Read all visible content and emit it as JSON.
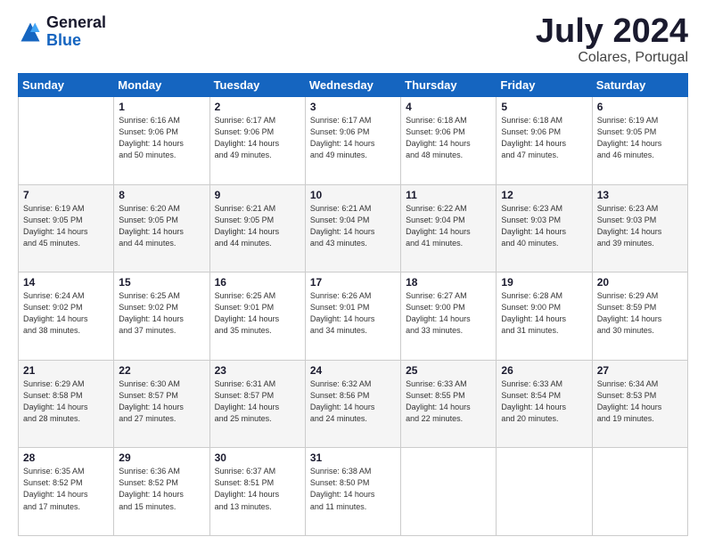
{
  "header": {
    "logo_general": "General",
    "logo_blue": "Blue",
    "title": "July 2024",
    "subtitle": "Colares, Portugal"
  },
  "weekdays": [
    "Sunday",
    "Monday",
    "Tuesday",
    "Wednesday",
    "Thursday",
    "Friday",
    "Saturday"
  ],
  "weeks": [
    [
      {
        "num": "",
        "info": ""
      },
      {
        "num": "1",
        "info": "Sunrise: 6:16 AM\nSunset: 9:06 PM\nDaylight: 14 hours\nand 50 minutes."
      },
      {
        "num": "2",
        "info": "Sunrise: 6:17 AM\nSunset: 9:06 PM\nDaylight: 14 hours\nand 49 minutes."
      },
      {
        "num": "3",
        "info": "Sunrise: 6:17 AM\nSunset: 9:06 PM\nDaylight: 14 hours\nand 49 minutes."
      },
      {
        "num": "4",
        "info": "Sunrise: 6:18 AM\nSunset: 9:06 PM\nDaylight: 14 hours\nand 48 minutes."
      },
      {
        "num": "5",
        "info": "Sunrise: 6:18 AM\nSunset: 9:06 PM\nDaylight: 14 hours\nand 47 minutes."
      },
      {
        "num": "6",
        "info": "Sunrise: 6:19 AM\nSunset: 9:05 PM\nDaylight: 14 hours\nand 46 minutes."
      }
    ],
    [
      {
        "num": "7",
        "info": "Sunrise: 6:19 AM\nSunset: 9:05 PM\nDaylight: 14 hours\nand 45 minutes."
      },
      {
        "num": "8",
        "info": "Sunrise: 6:20 AM\nSunset: 9:05 PM\nDaylight: 14 hours\nand 44 minutes."
      },
      {
        "num": "9",
        "info": "Sunrise: 6:21 AM\nSunset: 9:05 PM\nDaylight: 14 hours\nand 44 minutes."
      },
      {
        "num": "10",
        "info": "Sunrise: 6:21 AM\nSunset: 9:04 PM\nDaylight: 14 hours\nand 43 minutes."
      },
      {
        "num": "11",
        "info": "Sunrise: 6:22 AM\nSunset: 9:04 PM\nDaylight: 14 hours\nand 41 minutes."
      },
      {
        "num": "12",
        "info": "Sunrise: 6:23 AM\nSunset: 9:03 PM\nDaylight: 14 hours\nand 40 minutes."
      },
      {
        "num": "13",
        "info": "Sunrise: 6:23 AM\nSunset: 9:03 PM\nDaylight: 14 hours\nand 39 minutes."
      }
    ],
    [
      {
        "num": "14",
        "info": "Sunrise: 6:24 AM\nSunset: 9:02 PM\nDaylight: 14 hours\nand 38 minutes."
      },
      {
        "num": "15",
        "info": "Sunrise: 6:25 AM\nSunset: 9:02 PM\nDaylight: 14 hours\nand 37 minutes."
      },
      {
        "num": "16",
        "info": "Sunrise: 6:25 AM\nSunset: 9:01 PM\nDaylight: 14 hours\nand 35 minutes."
      },
      {
        "num": "17",
        "info": "Sunrise: 6:26 AM\nSunset: 9:01 PM\nDaylight: 14 hours\nand 34 minutes."
      },
      {
        "num": "18",
        "info": "Sunrise: 6:27 AM\nSunset: 9:00 PM\nDaylight: 14 hours\nand 33 minutes."
      },
      {
        "num": "19",
        "info": "Sunrise: 6:28 AM\nSunset: 9:00 PM\nDaylight: 14 hours\nand 31 minutes."
      },
      {
        "num": "20",
        "info": "Sunrise: 6:29 AM\nSunset: 8:59 PM\nDaylight: 14 hours\nand 30 minutes."
      }
    ],
    [
      {
        "num": "21",
        "info": "Sunrise: 6:29 AM\nSunset: 8:58 PM\nDaylight: 14 hours\nand 28 minutes."
      },
      {
        "num": "22",
        "info": "Sunrise: 6:30 AM\nSunset: 8:57 PM\nDaylight: 14 hours\nand 27 minutes."
      },
      {
        "num": "23",
        "info": "Sunrise: 6:31 AM\nSunset: 8:57 PM\nDaylight: 14 hours\nand 25 minutes."
      },
      {
        "num": "24",
        "info": "Sunrise: 6:32 AM\nSunset: 8:56 PM\nDaylight: 14 hours\nand 24 minutes."
      },
      {
        "num": "25",
        "info": "Sunrise: 6:33 AM\nSunset: 8:55 PM\nDaylight: 14 hours\nand 22 minutes."
      },
      {
        "num": "26",
        "info": "Sunrise: 6:33 AM\nSunset: 8:54 PM\nDaylight: 14 hours\nand 20 minutes."
      },
      {
        "num": "27",
        "info": "Sunrise: 6:34 AM\nSunset: 8:53 PM\nDaylight: 14 hours\nand 19 minutes."
      }
    ],
    [
      {
        "num": "28",
        "info": "Sunrise: 6:35 AM\nSunset: 8:52 PM\nDaylight: 14 hours\nand 17 minutes."
      },
      {
        "num": "29",
        "info": "Sunrise: 6:36 AM\nSunset: 8:52 PM\nDaylight: 14 hours\nand 15 minutes."
      },
      {
        "num": "30",
        "info": "Sunrise: 6:37 AM\nSunset: 8:51 PM\nDaylight: 14 hours\nand 13 minutes."
      },
      {
        "num": "31",
        "info": "Sunrise: 6:38 AM\nSunset: 8:50 PM\nDaylight: 14 hours\nand 11 minutes."
      },
      {
        "num": "",
        "info": ""
      },
      {
        "num": "",
        "info": ""
      },
      {
        "num": "",
        "info": ""
      }
    ]
  ]
}
